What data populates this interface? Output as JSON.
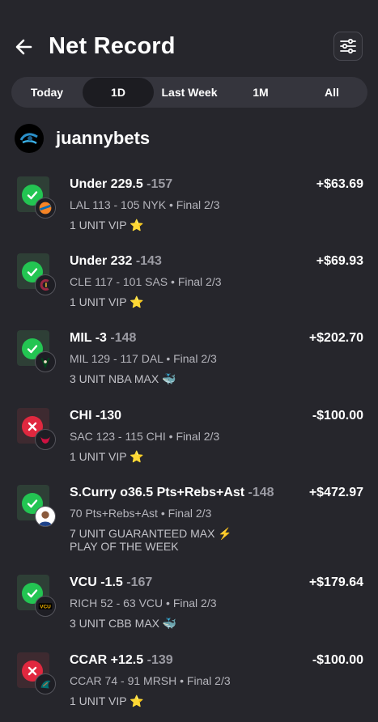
{
  "header": {
    "title": "Net Record",
    "back_icon": "arrow-left-icon",
    "filter_icon": "sliders-icon"
  },
  "tabs": [
    {
      "label": "Today",
      "active": false
    },
    {
      "label": "1D",
      "active": true
    },
    {
      "label": "Last Week",
      "active": false
    },
    {
      "label": "1M",
      "active": false
    },
    {
      "label": "All",
      "active": false
    }
  ],
  "profile": {
    "username": "juannybets"
  },
  "colors": {
    "win": "#23c552",
    "loss": "#e0283f",
    "background": "#26262c",
    "tabs_bg": "#35353d"
  },
  "bets": [
    {
      "status": "win",
      "pick": "Under 229.5",
      "odds": "-157",
      "amount": "+$63.69",
      "score": "LAL 113 - 105 NYK • Final 2/3",
      "note": "1 UNIT VIP ⭐",
      "team_icon": "knicks-logo-icon"
    },
    {
      "status": "win",
      "pick": "Under 232",
      "odds": "-143",
      "amount": "+$69.93",
      "score": "CLE 117 - 101 SAS • Final 2/3",
      "note": "1 UNIT VIP ⭐",
      "team_icon": "cavaliers-logo-icon"
    },
    {
      "status": "win",
      "pick": "MIL -3",
      "odds": "-148",
      "amount": "+$202.70",
      "score": "MIL 129 - 117 DAL • Final 2/3",
      "note": "3 UNIT NBA MAX 🐳",
      "team_icon": "bucks-logo-icon"
    },
    {
      "status": "loss",
      "pick": "CHI -130",
      "odds": "",
      "amount": "-$100.00",
      "score": "SAC 123 - 115 CHI • Final 2/3",
      "note": "1 UNIT VIP ⭐",
      "team_icon": "bulls-logo-icon"
    },
    {
      "status": "win",
      "pick": "S.Curry o36.5 Pts+Rebs+Ast",
      "odds": "-148",
      "amount": "+$472.97",
      "score": "70 Pts+Rebs+Ast • Final 2/3",
      "note": "7 UNIT GUARANTEED MAX ⚡\nPLAY OF THE WEEK",
      "team_icon": "player-headshot-icon"
    },
    {
      "status": "win",
      "pick": "VCU -1.5",
      "odds": "-167",
      "amount": "+$179.64",
      "score": "RICH 52 - 63 VCU • Final 2/3",
      "note": "3 UNIT CBB MAX 🐳",
      "team_icon": "vcu-logo-icon"
    },
    {
      "status": "loss",
      "pick": "CCAR +12.5",
      "odds": "-139",
      "amount": "-$100.00",
      "score": "CCAR 74 - 91 MRSH • Final 2/3",
      "note": "1 UNIT VIP ⭐",
      "team_icon": "coastal-carolina-logo-icon"
    }
  ]
}
